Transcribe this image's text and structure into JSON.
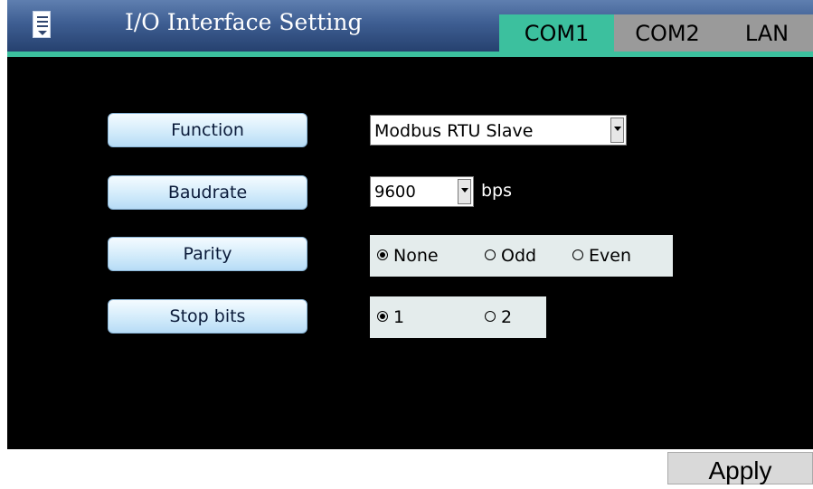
{
  "header": {
    "title": "I/O Interface Setting",
    "menu_icon": "menu-icon",
    "tabs": [
      {
        "label": "COM1",
        "active": true
      },
      {
        "label": "COM2",
        "active": false
      },
      {
        "label": "LAN",
        "active": false
      }
    ]
  },
  "settings": {
    "function": {
      "label": "Function",
      "value": "Modbus RTU Slave"
    },
    "baudrate": {
      "label": "Baudrate",
      "value": "9600",
      "unit": "bps"
    },
    "parity": {
      "label": "Parity",
      "options": [
        {
          "label": "None",
          "selected": true
        },
        {
          "label": "Odd",
          "selected": false
        },
        {
          "label": "Even",
          "selected": false
        }
      ]
    },
    "stop_bits": {
      "label": "Stop bits",
      "options": [
        {
          "label": "1",
          "selected": true
        },
        {
          "label": "2",
          "selected": false
        }
      ]
    }
  },
  "footer": {
    "apply_label": "Apply"
  },
  "colors": {
    "header_bg": "#3e5e92",
    "tab_active": "#3cc09e",
    "tab_inactive": "#9a9a9a",
    "screen_bg": "#000000",
    "radio_bg": "#e4ecec"
  }
}
